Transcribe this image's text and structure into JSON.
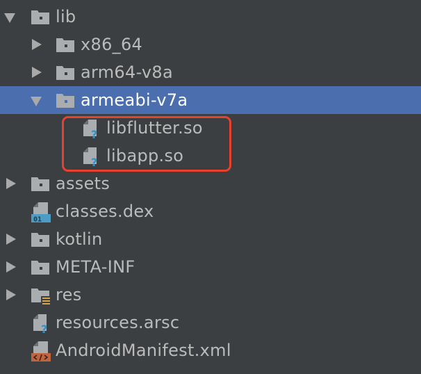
{
  "project_tree": {
    "items": [
      {
        "label": "lib",
        "type": "folder",
        "state": "expanded",
        "selected": false
      },
      {
        "label": "x86_64",
        "type": "folder",
        "state": "collapsed",
        "selected": false
      },
      {
        "label": "arm64-v8a",
        "type": "folder",
        "state": "collapsed",
        "selected": false
      },
      {
        "label": "armeabi-v7a",
        "type": "folder",
        "state": "expanded",
        "selected": true
      },
      {
        "label": "libflutter.so",
        "type": "file-unknown",
        "selected": false
      },
      {
        "label": "libapp.so",
        "type": "file-unknown",
        "selected": false
      },
      {
        "label": "assets",
        "type": "folder",
        "state": "collapsed",
        "selected": false
      },
      {
        "label": "classes.dex",
        "type": "file-dex",
        "selected": false
      },
      {
        "label": "kotlin",
        "type": "folder",
        "state": "collapsed",
        "selected": false
      },
      {
        "label": "META-INF",
        "type": "folder",
        "state": "collapsed",
        "selected": false
      },
      {
        "label": "res",
        "type": "folder-resources",
        "state": "collapsed",
        "selected": false
      },
      {
        "label": "resources.arsc",
        "type": "file-unknown",
        "selected": false
      },
      {
        "label": "AndroidManifest.xml",
        "type": "file-xml",
        "selected": false
      }
    ],
    "dex_badge": "01"
  },
  "colors": {
    "background": "#3c3f41",
    "selection": "#4b6eaf",
    "text": "#bbbbbb",
    "highlight_border": "#e8412e",
    "folder_icon": "#a9adb0",
    "question_mark": "#3592c4",
    "dex_badge": "#4e9bc4",
    "xml_badge": "#c0653d"
  },
  "icons": {
    "folder": "folder-icon",
    "unknown_file": "unknown-file-icon",
    "dex_file": "dex-file-icon",
    "xml_file": "xml-file-icon",
    "resources_folder": "resources-folder-icon"
  }
}
